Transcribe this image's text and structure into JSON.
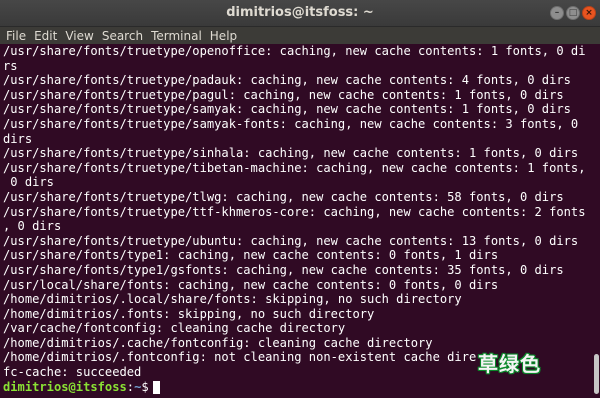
{
  "window": {
    "title": "dimitrios@itsfoss: ~",
    "controls": {
      "minimize": "–",
      "maximize": "□",
      "close": "×"
    },
    "accent_close": "#e95420",
    "background": "#300a24"
  },
  "menu": [
    {
      "label": "File"
    },
    {
      "label": "Edit"
    },
    {
      "label": "View"
    },
    {
      "label": "Search"
    },
    {
      "label": "Terminal"
    },
    {
      "label": "Help"
    }
  ],
  "terminal": {
    "lines": [
      "/usr/share/fonts/truetype/openoffice: caching, new cache contents: 1 fonts, 0 di",
      "rs",
      "/usr/share/fonts/truetype/padauk: caching, new cache contents: 4 fonts, 0 dirs",
      "/usr/share/fonts/truetype/pagul: caching, new cache contents: 1 fonts, 0 dirs",
      "/usr/share/fonts/truetype/samyak: caching, new cache contents: 1 fonts, 0 dirs",
      "/usr/share/fonts/truetype/samyak-fonts: caching, new cache contents: 3 fonts, 0",
      "dirs",
      "/usr/share/fonts/truetype/sinhala: caching, new cache contents: 1 fonts, 0 dirs",
      "/usr/share/fonts/truetype/tibetan-machine: caching, new cache contents: 1 fonts,",
      " 0 dirs",
      "/usr/share/fonts/truetype/tlwg: caching, new cache contents: 58 fonts, 0 dirs",
      "/usr/share/fonts/truetype/ttf-khmeros-core: caching, new cache contents: 2 fonts",
      ", 0 dirs",
      "/usr/share/fonts/truetype/ubuntu: caching, new cache contents: 13 fonts, 0 dirs",
      "/usr/share/fonts/type1: caching, new cache contents: 0 fonts, 1 dirs",
      "/usr/share/fonts/type1/gsfonts: caching, new cache contents: 35 fonts, 0 dirs",
      "/usr/local/share/fonts: caching, new cache contents: 0 fonts, 0 dirs",
      "/home/dimitrios/.local/share/fonts: skipping, no such directory",
      "/home/dimitrios/.fonts: skipping, no such directory",
      "/var/cache/fontconfig: cleaning cache directory",
      "/home/dimitrios/.cache/fontconfig: cleaning cache directory",
      "/home/dimitrios/.fontconfig: not cleaning non-existent cache dire",
      "fc-cache: succeeded"
    ],
    "prompt": {
      "user_host": "dimitrios@itsfoss",
      "separator": ":",
      "path": "~",
      "symbol": "$"
    }
  },
  "watermark": "草绿色"
}
